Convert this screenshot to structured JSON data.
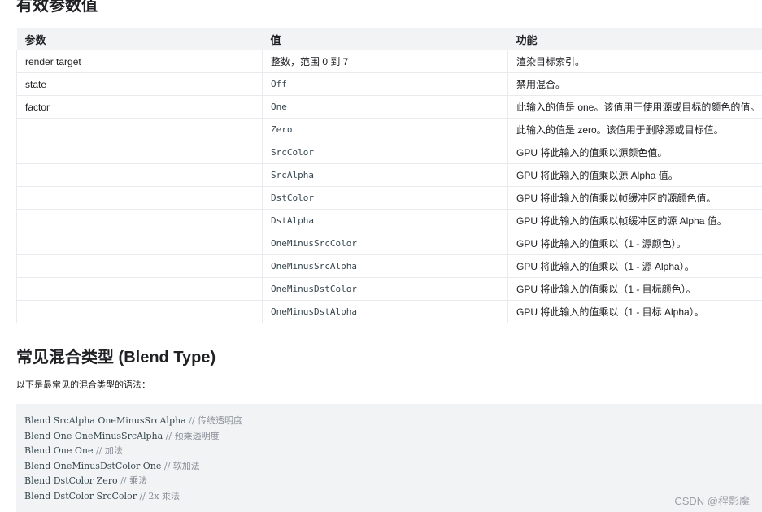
{
  "section1": {
    "title": "有效参数值",
    "table": {
      "headers": [
        "参数",
        "值",
        "功能"
      ],
      "rows": [
        {
          "param": "render target",
          "value": "整数，范围 0 到 7",
          "func": "渲染目标索引。",
          "mono": false
        },
        {
          "param": "state",
          "value": "Off",
          "func": "禁用混合。",
          "mono": true
        },
        {
          "param": "factor",
          "value": "One",
          "func": "此输入的值是 one。该值用于使用源或目标的颜色的值。",
          "mono": true
        },
        {
          "param": "",
          "value": "Zero",
          "func": "此输入的值是 zero。该值用于删除源或目标值。",
          "mono": true
        },
        {
          "param": "",
          "value": "SrcColor",
          "func": "GPU 将此输入的值乘以源颜色值。",
          "mono": true
        },
        {
          "param": "",
          "value": "SrcAlpha",
          "func": "GPU 将此输入的值乘以源 Alpha 值。",
          "mono": true
        },
        {
          "param": "",
          "value": "DstColor",
          "func": "GPU 将此输入的值乘以帧缓冲区的源颜色值。",
          "mono": true
        },
        {
          "param": "",
          "value": "DstAlpha",
          "func": "GPU 将此输入的值乘以帧缓冲区的源 Alpha 值。",
          "mono": true
        },
        {
          "param": "",
          "value": "OneMinusSrcColor",
          "func": "GPU 将此输入的值乘以（1 - 源颜色）。",
          "mono": true
        },
        {
          "param": "",
          "value": "OneMinusSrcAlpha",
          "func": "GPU 将此输入的值乘以（1 - 源 Alpha）。",
          "mono": true
        },
        {
          "param": "",
          "value": "OneMinusDstColor",
          "func": "GPU 将此输入的值乘以（1 - 目标颜色）。",
          "mono": true
        },
        {
          "param": "",
          "value": "OneMinusDstAlpha",
          "func": "GPU 将此输入的值乘以（1 - 目标 Alpha）。",
          "mono": true
        }
      ]
    }
  },
  "section2": {
    "title": "常见混合类型 (Blend Type)",
    "intro": "以下是最常见的混合类型的语法：",
    "code": [
      {
        "code": "Blend SrcAlpha OneMinusSrcAlpha ",
        "comment": "// 传统透明度"
      },
      {
        "code": "Blend One OneMinusSrcAlpha ",
        "comment": "// 预乘透明度"
      },
      {
        "code": "Blend One One ",
        "comment": "// 加法"
      },
      {
        "code": "Blend OneMinusDstColor One ",
        "comment": "// 软加法"
      },
      {
        "code": "Blend DstColor Zero ",
        "comment": "// 乘法"
      },
      {
        "code": "Blend DstColor SrcColor ",
        "comment": "// 2x 乘法"
      }
    ]
  },
  "watermark": "CSDN @程影魔"
}
